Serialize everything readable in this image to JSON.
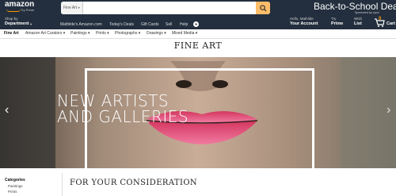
{
  "header": {
    "logo": "amazon",
    "logo_sub": "Try Prime",
    "search_scope": "Fine Art",
    "search_value": "",
    "promo_title": "Back-to-School Deals",
    "promo_sub": "Sponsored by Lysol"
  },
  "nav": {
    "ship_small": "Shop by",
    "ship_bold": "Department",
    "links": [
      "Mathilde's Amazon.com",
      "Today's Deals",
      "Gift Cards",
      "Sell",
      "Help"
    ],
    "account_small": "Hello, Mathilde",
    "account_bold": "Your Account",
    "prime_small": "Try",
    "prime_bold": "Prime",
    "list_small": "Wish",
    "list_bold": "List",
    "cart_count": "0",
    "cart_label": "Cart"
  },
  "subnav": {
    "items": [
      "Fine Art",
      "Amazon Art Curators",
      "Paintings",
      "Prints",
      "Photographs",
      "Drawings",
      "Mixed Media"
    ]
  },
  "page": {
    "title": "FINE ART"
  },
  "hero": {
    "line1": "NEW ARTISTS",
    "line2": "AND GALLERIES"
  },
  "sidebar": {
    "title": "Categories",
    "items": [
      "Paintings",
      "Prints"
    ]
  },
  "main": {
    "section_title": "FOR YOUR CONSIDERATION"
  },
  "colors": {
    "nav_bg": "#232f3e",
    "accent": "#febd69",
    "orange": "#ff9900"
  }
}
